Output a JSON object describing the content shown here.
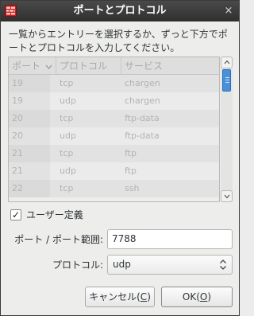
{
  "window": {
    "title": "ポートとプロトコル",
    "icon": "firewall-app-icon",
    "close_glyph": "×"
  },
  "description": "一覧からエントリーを選択するか、ずっと下方でポートとプロトコルを入力してください。",
  "list": {
    "headers": {
      "port": "ポート",
      "protocol": "プロトコル",
      "service": "サービス"
    },
    "sort_indicator": "chevron-down",
    "rows": [
      {
        "port": "19",
        "protocol": "tcp",
        "service": "chargen"
      },
      {
        "port": "19",
        "protocol": "udp",
        "service": "chargen"
      },
      {
        "port": "20",
        "protocol": "tcp",
        "service": "ftp-data"
      },
      {
        "port": "20",
        "protocol": "udp",
        "service": "ftp-data"
      },
      {
        "port": "21",
        "protocol": "tcp",
        "service": "ftp"
      },
      {
        "port": "21",
        "protocol": "udp",
        "service": "ftp"
      },
      {
        "port": "22",
        "protocol": "tcp",
        "service": "ssh"
      }
    ]
  },
  "user_defined": {
    "label": "ユーザー定義",
    "checked": true,
    "check_glyph": "✓"
  },
  "port_field": {
    "label": "ポート / ポート範囲:",
    "value": "7788"
  },
  "protocol_field": {
    "label": "プロトコル:",
    "value": "udp"
  },
  "buttons": {
    "cancel_label": "キャンセル(",
    "cancel_mnemonic": "C",
    "cancel_suffix": ")",
    "ok_label": "OK(",
    "ok_mnemonic": "O",
    "ok_suffix": ")"
  },
  "colors": {
    "titlebar": "#2f2f2f",
    "scroll_thumb": "#4a90d9",
    "icon_red": "#c8201d"
  }
}
